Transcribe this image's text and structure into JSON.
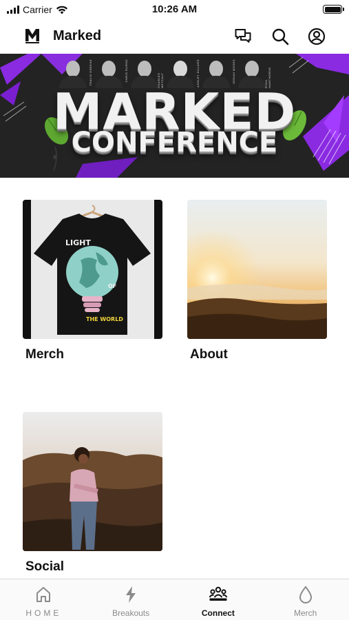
{
  "status_bar": {
    "carrier": "Carrier",
    "time": "10:26 AM"
  },
  "header": {
    "title": "Marked",
    "logo": "M",
    "icons": [
      "chat-icon",
      "search-icon",
      "account-icon"
    ]
  },
  "banner": {
    "line1": "MARKED",
    "line2": "CONFERENCE",
    "speakers": [
      "TRAVIS GREENE",
      "CHRIS DURSO",
      "CHARLES METCALF",
      "ASHLEY DILLARD",
      "JOSIAH MOSES",
      "RYAN HAWTHORNE"
    ]
  },
  "tiles": [
    {
      "label": "Merch",
      "shirt_text_top": "LIGHT",
      "shirt_text_mid": "OF",
      "shirt_text_bottom": "THE WORLD"
    },
    {
      "label": "About"
    },
    {
      "label": "Social"
    }
  ],
  "tabs": [
    {
      "label": "HOME",
      "icon": "home-icon",
      "active": false
    },
    {
      "label": "Breakouts",
      "icon": "lightning-icon",
      "active": false
    },
    {
      "label": "Connect",
      "icon": "people-icon",
      "active": true
    },
    {
      "label": "Merch",
      "icon": "drop-icon",
      "active": false
    }
  ],
  "colors": {
    "accent_purple": "#8a2be2",
    "banner_bg": "#232323",
    "active_tab": "#111111",
    "inactive_tab": "#8a8a8a"
  }
}
